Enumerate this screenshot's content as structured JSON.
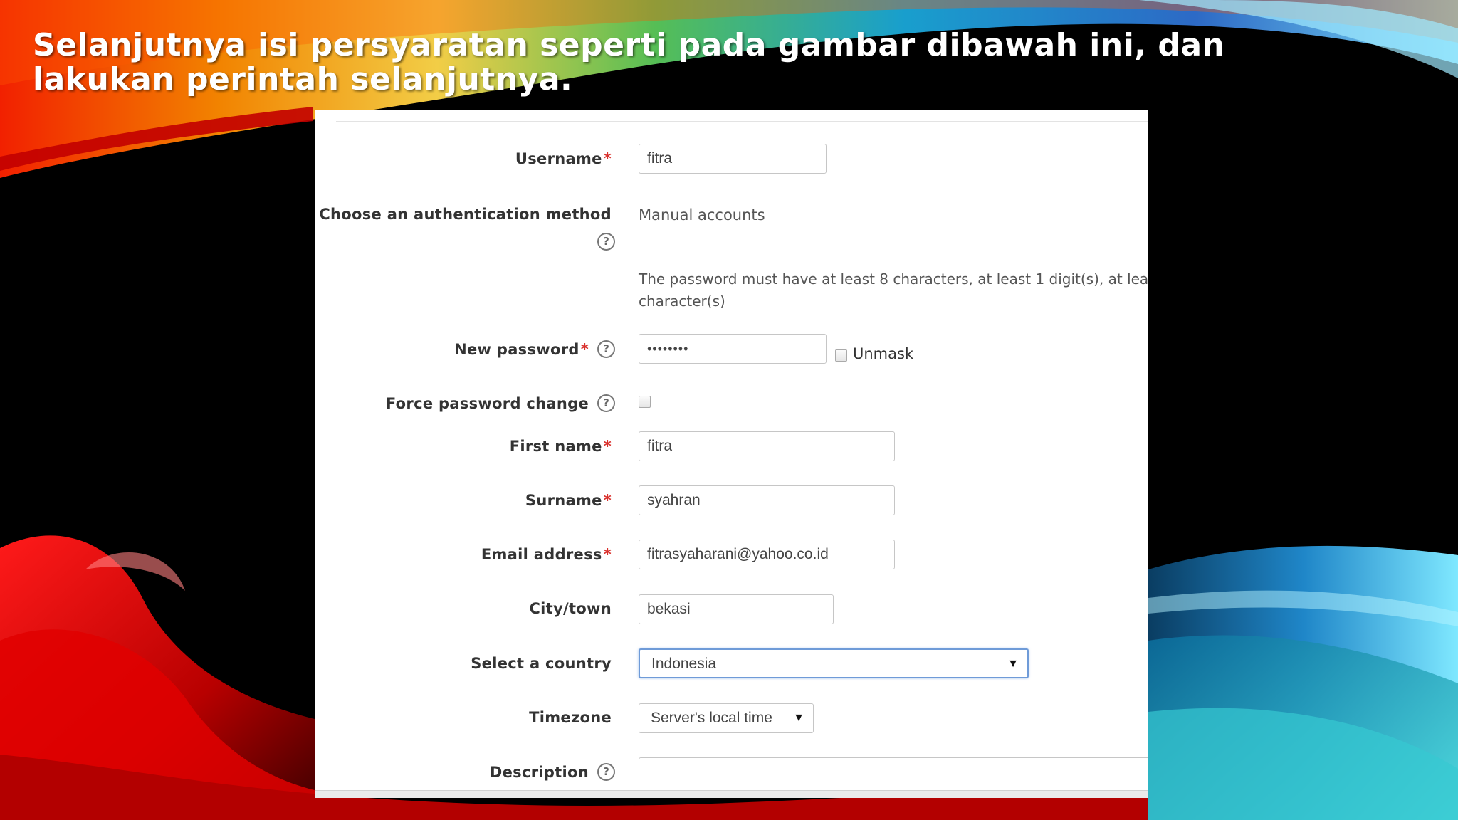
{
  "slide": {
    "title": "Selanjutnya isi persyaratan seperti pada gambar dibawah ini, dan lakukan perintah selanjutnya."
  },
  "form": {
    "required_marker": "*",
    "help_glyph": "?",
    "username": {
      "label": "Username",
      "value": "fitra"
    },
    "auth": {
      "label": "Choose an authentication method",
      "value": "Manual accounts"
    },
    "password_note": {
      "line1": "The password must have at least 8 characters, at least 1 digit(s), at lea",
      "line2": "character(s)"
    },
    "new_password": {
      "label": "New password",
      "value": "••••••••",
      "unmask_label": "Unmask"
    },
    "force_password_change": {
      "label": "Force password change"
    },
    "first_name": {
      "label": "First name",
      "value": "fitra"
    },
    "surname": {
      "label": "Surname",
      "value": "syahran"
    },
    "email": {
      "label": "Email address",
      "value": "fitrasyaharani@yahoo.co.id"
    },
    "city": {
      "label": "City/town",
      "value": "bekasi"
    },
    "country": {
      "label": "Select a country",
      "value": "Indonesia"
    },
    "timezone": {
      "label": "Timezone",
      "value": "Server's local time"
    },
    "description": {
      "label": "Description"
    },
    "dropdown_arrow": "▼"
  },
  "colors": {
    "required": "#d9302c",
    "focus_border": "#6f9bd8",
    "panel": "#ffffff"
  },
  "icons": [
    "help-icon",
    "dropdown-arrow-icon",
    "checkbox"
  ]
}
